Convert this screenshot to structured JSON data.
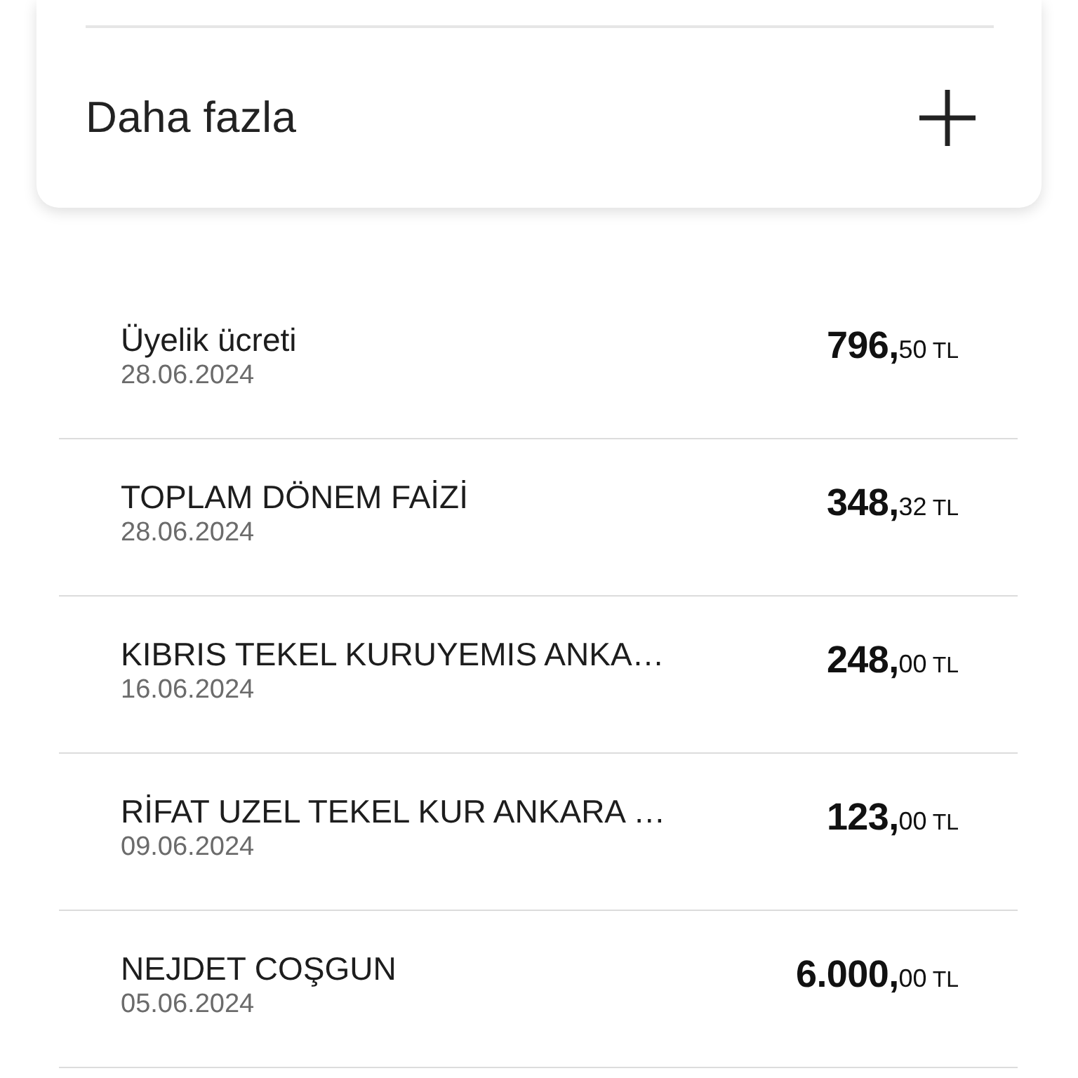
{
  "more_section": {
    "label": "Daha fazla",
    "expanded": false
  },
  "transactions": [
    {
      "name": "Üyelik ücreti",
      "date": "28.06.2024",
      "amount_whole": "796,",
      "amount_cents": "50",
      "currency": "TL"
    },
    {
      "name": "TOPLAM DÖNEM FAİZİ",
      "date": "28.06.2024",
      "amount_whole": "348,",
      "amount_cents": "32",
      "currency": "TL"
    },
    {
      "name": "KIBRIS TEKEL KURUYEMIS ANKA…",
      "date": "16.06.2024",
      "amount_whole": "248,",
      "amount_cents": "00",
      "currency": "TL"
    },
    {
      "name": "RİFAT UZEL TEKEL KUR ANKARA …",
      "date": "09.06.2024",
      "amount_whole": "123,",
      "amount_cents": "00",
      "currency": "TL"
    },
    {
      "name": "NEJDET COŞGUN",
      "date": "05.06.2024",
      "amount_whole": "6.000,",
      "amount_cents": "00",
      "currency": "TL"
    }
  ]
}
